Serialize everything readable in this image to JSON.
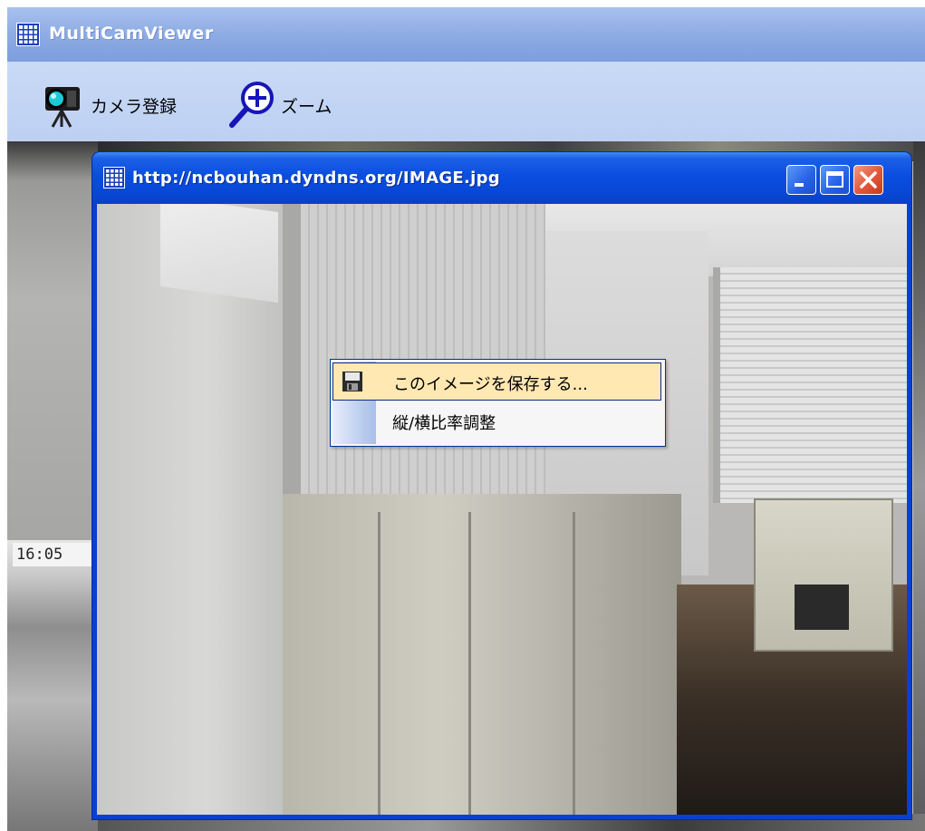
{
  "app": {
    "title": "MultiCamViewer",
    "title_icon": "grid-icon",
    "titlebar_color": "#8eace4"
  },
  "toolbar": {
    "register_camera_label": "カメラ登録",
    "register_camera_icon": "camera-icon",
    "zoom_label": "ズーム",
    "zoom_icon": "zoom-in-icon"
  },
  "camera_grid": {
    "timestamp": "16:05"
  },
  "child_window": {
    "title": "http://ncbouhan.dyndns.org/IMAGE.jpg",
    "title_icon": "grid-icon",
    "titlebar_color": "#0a4ee0",
    "buttons": [
      "minimize-icon",
      "maximize-icon",
      "close-icon"
    ]
  },
  "context_menu": {
    "items": [
      {
        "label": "このイメージを保存する...",
        "icon": "floppy-disk-icon",
        "highlighted": true
      },
      {
        "label": "縦/横比率調整",
        "icon": "",
        "highlighted": false
      }
    ],
    "highlight_color": "#ffe8b2",
    "border_color": "#003399"
  }
}
